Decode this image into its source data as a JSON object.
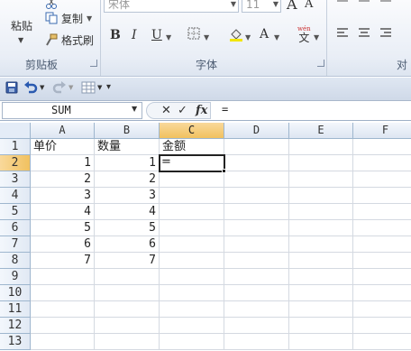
{
  "ribbon": {
    "clipboard": {
      "paste_label": "粘贴",
      "cut_label": "剪切",
      "copy_label": "复制",
      "format_painter_label": "格式刷",
      "group_label": "剪贴板"
    },
    "font": {
      "font_name": "宋体",
      "font_size": "11",
      "group_label": "字体"
    },
    "alignment": {
      "group_label": "对"
    }
  },
  "qat": {
    "icons": [
      "save-icon",
      "undo-icon",
      "redo-icon",
      "table-icon",
      "customize-icon"
    ]
  },
  "formula_bar": {
    "name_box": "SUM",
    "formula": "=",
    "cancel": "✕",
    "enter": "✓",
    "fx": "fx"
  },
  "grid": {
    "columns": [
      "A",
      "B",
      "C",
      "D",
      "E",
      "F"
    ],
    "active_column": "C",
    "active_row": "2",
    "rows": [
      {
        "num": "1",
        "cells": [
          "单价",
          "数量",
          "金额",
          "",
          "",
          ""
        ]
      },
      {
        "num": "2",
        "cells": [
          "1",
          "1",
          "=",
          "",
          "",
          ""
        ]
      },
      {
        "num": "3",
        "cells": [
          "2",
          "2",
          "",
          "",
          "",
          ""
        ]
      },
      {
        "num": "4",
        "cells": [
          "3",
          "3",
          "",
          "",
          "",
          ""
        ]
      },
      {
        "num": "5",
        "cells": [
          "4",
          "4",
          "",
          "",
          "",
          ""
        ]
      },
      {
        "num": "6",
        "cells": [
          "5",
          "5",
          "",
          "",
          "",
          ""
        ]
      },
      {
        "num": "7",
        "cells": [
          "6",
          "6",
          "",
          "",
          "",
          ""
        ]
      },
      {
        "num": "8",
        "cells": [
          "7",
          "7",
          "",
          "",
          "",
          ""
        ]
      },
      {
        "num": "9",
        "cells": [
          "",
          "",
          "",
          "",
          "",
          ""
        ]
      },
      {
        "num": "10",
        "cells": [
          "",
          "",
          "",
          "",
          "",
          ""
        ]
      },
      {
        "num": "11",
        "cells": [
          "",
          "",
          "",
          "",
          "",
          ""
        ]
      },
      {
        "num": "12",
        "cells": [
          "",
          "",
          "",
          "",
          "",
          ""
        ]
      },
      {
        "num": "13",
        "cells": [
          "",
          "",
          "",
          "",
          "",
          ""
        ]
      }
    ]
  }
}
